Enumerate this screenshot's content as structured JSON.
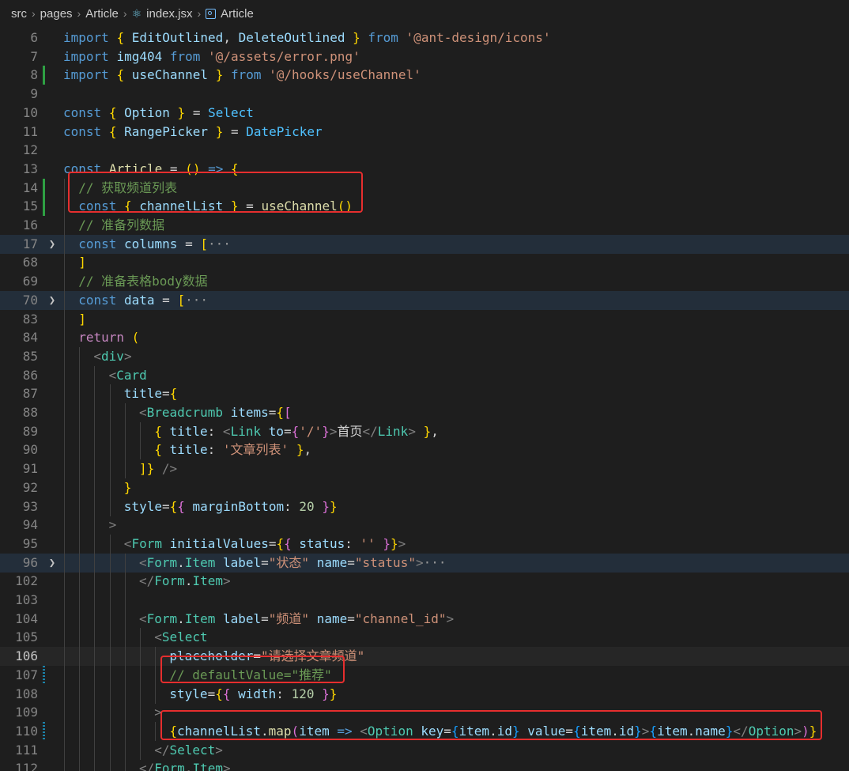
{
  "breadcrumb": {
    "items": [
      "src",
      "pages",
      "Article",
      "index.jsx",
      "Article"
    ],
    "icons": [
      "chevron-right-icon",
      "react-file-icon",
      "symbol-class-icon"
    ]
  },
  "editor": {
    "active_line": "106",
    "lines": [
      {
        "n": "6",
        "text": "import { EditOutlined, DeleteOutlined } from '@ant-design/icons'"
      },
      {
        "n": "7",
        "text": "import img404 from '@/assets/error.png'"
      },
      {
        "n": "8",
        "text": "import { useChannel } from '@/hooks/useChannel'"
      },
      {
        "n": "9",
        "text": ""
      },
      {
        "n": "10",
        "text": "const { Option } = Select"
      },
      {
        "n": "11",
        "text": "const { RangePicker } = DatePicker"
      },
      {
        "n": "12",
        "text": ""
      },
      {
        "n": "13",
        "text": "const Article = () => {"
      },
      {
        "n": "14",
        "text": "// 获取频道列表"
      },
      {
        "n": "15",
        "text": "const { channelList } = useChannel()"
      },
      {
        "n": "16",
        "text": "// 准备列数据"
      },
      {
        "n": "17",
        "text": "const columns = [···"
      },
      {
        "n": "68",
        "text": "]"
      },
      {
        "n": "69",
        "text": "// 准备表格body数据"
      },
      {
        "n": "70",
        "text": "const data = [···"
      },
      {
        "n": "83",
        "text": "]"
      },
      {
        "n": "84",
        "text": "return ("
      },
      {
        "n": "85",
        "text": "<div>"
      },
      {
        "n": "86",
        "text": "<Card"
      },
      {
        "n": "87",
        "text": "title={"
      },
      {
        "n": "88",
        "text": "<Breadcrumb items={["
      },
      {
        "n": "89",
        "text": "{ title: <Link to={'/'}>首页</Link> },"
      },
      {
        "n": "90",
        "text": "{ title: '文章列表' },"
      },
      {
        "n": "91",
        "text": "]} />"
      },
      {
        "n": "92",
        "text": "}"
      },
      {
        "n": "93",
        "text": "style={{ marginBottom: 20 }}"
      },
      {
        "n": "94",
        "text": ">"
      },
      {
        "n": "95",
        "text": "<Form initialValues={{ status: '' }}>"
      },
      {
        "n": "96",
        "text": "<Form.Item label=\"状态\" name=\"status\">···"
      },
      {
        "n": "102",
        "text": "</Form.Item>"
      },
      {
        "n": "103",
        "text": ""
      },
      {
        "n": "104",
        "text": "<Form.Item label=\"频道\" name=\"channel_id\">"
      },
      {
        "n": "105",
        "text": "<Select"
      },
      {
        "n": "106",
        "text": "placeholder=\"请选择文章频道\""
      },
      {
        "n": "107",
        "text": "// defaultValue=\"推荐\""
      },
      {
        "n": "108",
        "text": "style={{ width: 120 }}"
      },
      {
        "n": "109",
        "text": ">"
      },
      {
        "n": "110",
        "text": "{channelList.map(item => <Option key={item.id} value={item.id}>{item.name}</Option>)}"
      },
      {
        "n": "111",
        "text": "</Select>"
      },
      {
        "n": "112",
        "text": "</Form.Item>"
      }
    ]
  },
  "annotations": {
    "color": "#e62e2e",
    "boxes": [
      "highlight-channel-hook",
      "highlight-default-value",
      "highlight-options-map"
    ]
  }
}
